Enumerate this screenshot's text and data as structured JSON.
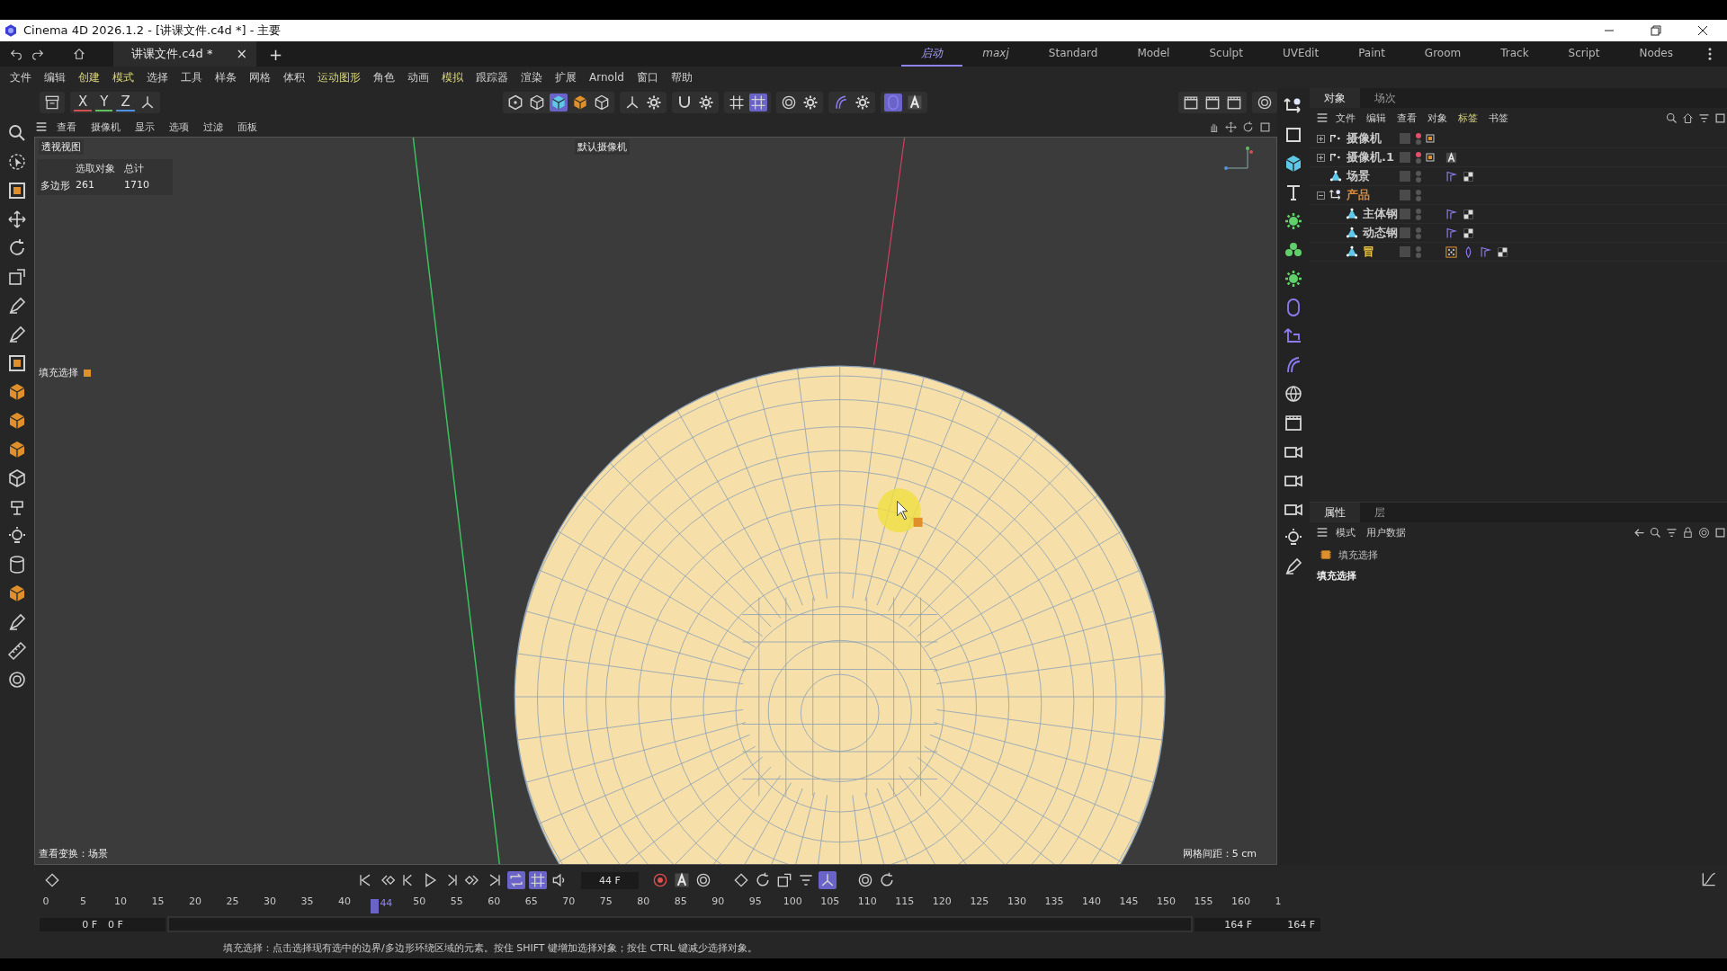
{
  "window": {
    "title": "Cinema 4D 2026.1.2 - [讲课文件.c4d *] - 主要"
  },
  "document_tabs": [
    {
      "label": "讲课文件.c4d *",
      "selected": true,
      "close": "×"
    }
  ],
  "add_tab": "+",
  "layouts": [
    {
      "label": "启动",
      "selected": true
    },
    {
      "label": "maxj",
      "selected": false
    },
    {
      "label": "Standard",
      "selected": false
    },
    {
      "label": "Model",
      "selected": false
    },
    {
      "label": "Sculpt",
      "selected": false
    },
    {
      "label": "UVEdit",
      "selected": false
    },
    {
      "label": "Paint",
      "selected": false
    },
    {
      "label": "Groom",
      "selected": false
    },
    {
      "label": "Track",
      "selected": false
    },
    {
      "label": "Script",
      "selected": false
    },
    {
      "label": "Nodes",
      "selected": false
    }
  ],
  "menu": [
    {
      "label": "文件",
      "highlighted": false
    },
    {
      "label": "编辑",
      "highlighted": false
    },
    {
      "label": "创建",
      "highlighted": true
    },
    {
      "label": "模式",
      "highlighted": true
    },
    {
      "label": "选择",
      "highlighted": false
    },
    {
      "label": "工具",
      "highlighted": false
    },
    {
      "label": "样条",
      "highlighted": false
    },
    {
      "label": "网格",
      "highlighted": false
    },
    {
      "label": "体积",
      "highlighted": false
    },
    {
      "label": "运动图形",
      "highlighted": true
    },
    {
      "label": "角色",
      "highlighted": false
    },
    {
      "label": "动画",
      "highlighted": false
    },
    {
      "label": "模拟",
      "highlighted": true
    },
    {
      "label": "跟踪器",
      "highlighted": false
    },
    {
      "label": "渲染",
      "highlighted": false
    },
    {
      "label": "扩展",
      "highlighted": false
    },
    {
      "label": "Arnold",
      "highlighted": false
    },
    {
      "label": "窗口",
      "highlighted": false
    },
    {
      "label": "帮助",
      "highlighted": false
    }
  ],
  "axis_buttons": [
    "X",
    "Y",
    "Z"
  ],
  "viewport_menu": [
    "查看",
    "摄像机",
    "显示",
    "选项",
    "过滤",
    "面板"
  ],
  "viewport": {
    "name": "透视视图",
    "camera": "默认摄像机",
    "stats_header": [
      "选取对象",
      "总计"
    ],
    "stats_row": {
      "label": "多边形",
      "selected": "261",
      "total": "1710"
    },
    "selection_tag": "填充选择",
    "transform_info": "查看变换：场景",
    "grid_spacing": "网格间距：5 cm"
  },
  "object_manager": {
    "tabs": [
      {
        "label": "对象",
        "selected": true
      },
      {
        "label": "场次",
        "selected": false
      }
    ],
    "menu": [
      {
        "label": "文件",
        "highlighted": false
      },
      {
        "label": "编辑",
        "highlighted": false
      },
      {
        "label": "查看",
        "highlighted": false
      },
      {
        "label": "对象",
        "highlighted": false
      },
      {
        "label": "标签",
        "highlighted": true
      },
      {
        "label": "书签",
        "highlighted": false
      }
    ],
    "objects": [
      {
        "name": "摄像机",
        "kind": "camera",
        "expanded": false,
        "color": "#c8c8c8"
      },
      {
        "name": "摄像机.1",
        "kind": "camera",
        "expanded": false,
        "color": "#c8c8c8",
        "tags": [
          {
            "kind": "annotation"
          }
        ]
      },
      {
        "name": "场景",
        "kind": "polygon",
        "color": "#c8c8c8",
        "tags": [
          {
            "kind": "phong"
          },
          {
            "kind": "material"
          }
        ]
      },
      {
        "name": "产品",
        "kind": "null",
        "expanded": true,
        "color": "#d98a3a",
        "children": [
          {
            "name": "主体钢",
            "kind": "polygon",
            "color": "#c8c8c8",
            "tags": [
              {
                "kind": "phong"
              },
              {
                "kind": "material"
              }
            ]
          },
          {
            "name": "动态钢",
            "kind": "polygon",
            "color": "#c8c8c8",
            "tags": [
              {
                "kind": "phong"
              },
              {
                "kind": "material"
              }
            ]
          },
          {
            "name": "冒",
            "kind": "polygon",
            "color": "#e8c040",
            "tags": [
              {
                "kind": "selection"
              },
              {
                "kind": "weight"
              },
              {
                "kind": "phong"
              },
              {
                "kind": "material"
              }
            ]
          }
        ]
      }
    ]
  },
  "attributes": {
    "tabs": [
      {
        "label": "属性",
        "selected": true
      },
      {
        "label": "层",
        "selected": false
      }
    ],
    "menu": [
      "模式",
      "用户数据"
    ],
    "tag_name": "填充选择",
    "section": "填充选择"
  },
  "timeline": {
    "current_frame": "44 F",
    "ticks": [
      "0",
      "5",
      "10",
      "15",
      "20",
      "25",
      "30",
      "35",
      "40",
      "50",
      "55",
      "60",
      "65",
      "70",
      "75",
      "80",
      "85",
      "90",
      "95",
      "100",
      "105",
      "110",
      "115",
      "120",
      "125",
      "130",
      "135",
      "140",
      "145",
      "150",
      "155",
      "160",
      "1"
    ],
    "playhead": {
      "label": "44",
      "level": 0.2667
    },
    "range": {
      "level": 1
    },
    "start_a": "0 F",
    "start_b": "0 F",
    "end_a": "164 F",
    "end_b": "164 F"
  },
  "status_bar": {
    "hint": "填充选择：点击选择现有选中的边界/多边形环绕区域的元素。按住 SHIFT 键增加选择对象；按住 CTRL 键减少选择对象。"
  }
}
